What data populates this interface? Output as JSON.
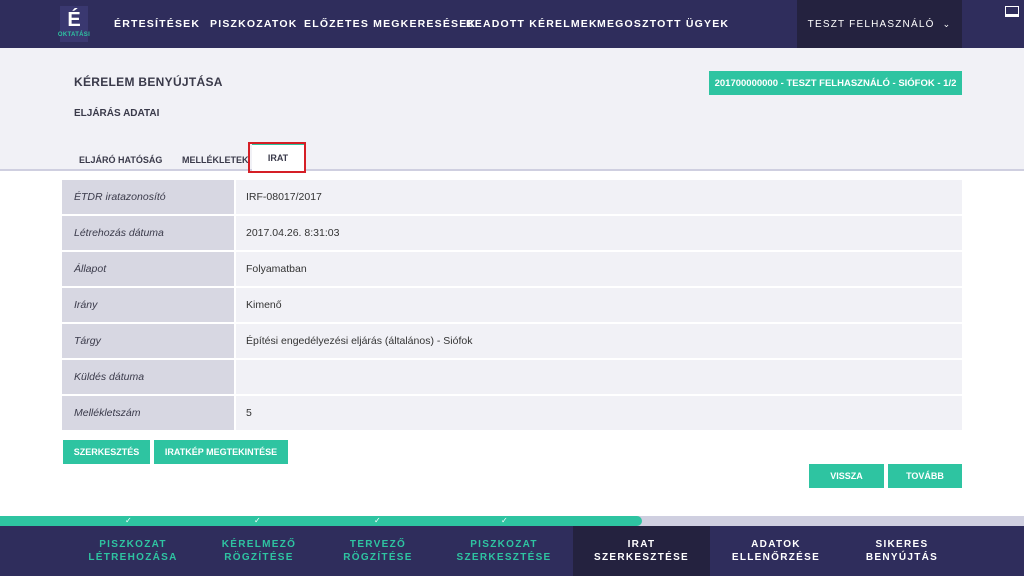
{
  "logo": {
    "glyph": "É",
    "subtitle": "OKTATÁSI"
  },
  "nav": {
    "items": [
      "ÉRTESÍTÉSEK",
      "PISZKOZATOK",
      "ELŐZETES MEGKERESÉSEK",
      "BEADOTT KÉRELMEK",
      "MEGOSZTOTT ÜGYEK"
    ],
    "user": "TESZT FELHASZNÁLÓ",
    "user_chevron": "⌄"
  },
  "page": {
    "title": "KÉRELEM BENYÚJTÁSA",
    "section": "ELJÁRÁS ADATAI",
    "case_badge": "201700000000 - TESZT FELHASZNÁLÓ - SIÓFOK - 1/2"
  },
  "tabs": [
    "ELJÁRÓ HATÓSÁG",
    "MELLÉKLETEK",
    "IRAT"
  ],
  "details": [
    {
      "label": "ÉTDR iratazonosító",
      "value": "IRF-08017/2017"
    },
    {
      "label": "Létrehozás dátuma",
      "value": "2017.04.26. 8:31:03"
    },
    {
      "label": "Állapot",
      "value": "Folyamatban"
    },
    {
      "label": "Irány",
      "value": "Kimenő"
    },
    {
      "label": "Tárgy",
      "value": "Építési engedélyezési eljárás (általános) - Siófok"
    },
    {
      "label": "Küldés dátuma",
      "value": ""
    },
    {
      "label": "Mellékletszám",
      "value": "5"
    }
  ],
  "actions": {
    "edit": "SZERKESZTÉS",
    "preview": "IRATKÉP MEGTEKINTÉSE",
    "back": "VISSZA",
    "next": "TOVÁBB"
  },
  "progress": {
    "fraction": 0.627,
    "check_glyph": "✓"
  },
  "steps": [
    {
      "label": "PISZKOZAT\nLÉTREHOZÁSA",
      "state": "done"
    },
    {
      "label": "KÉRELMEZŐ\nRÖGZÍTÉSE",
      "state": "done"
    },
    {
      "label": "TERVEZŐ\nRÖGZÍTÉSE",
      "state": "done"
    },
    {
      "label": "PISZKOZAT\nSZERKESZTÉSE",
      "state": "done"
    },
    {
      "label": "IRAT\nSZERKESZTÉSE",
      "state": "active"
    },
    {
      "label": "ADATOK\nELLENŐRZÉSE",
      "state": "todo"
    },
    {
      "label": "SIKERES\nBENYÚJTÁS",
      "state": "todo"
    }
  ],
  "colors": {
    "navy": "#2f2d5c",
    "navy_dark": "#24223f",
    "accent": "#2ec4a1",
    "highlight": "#d51f26"
  }
}
